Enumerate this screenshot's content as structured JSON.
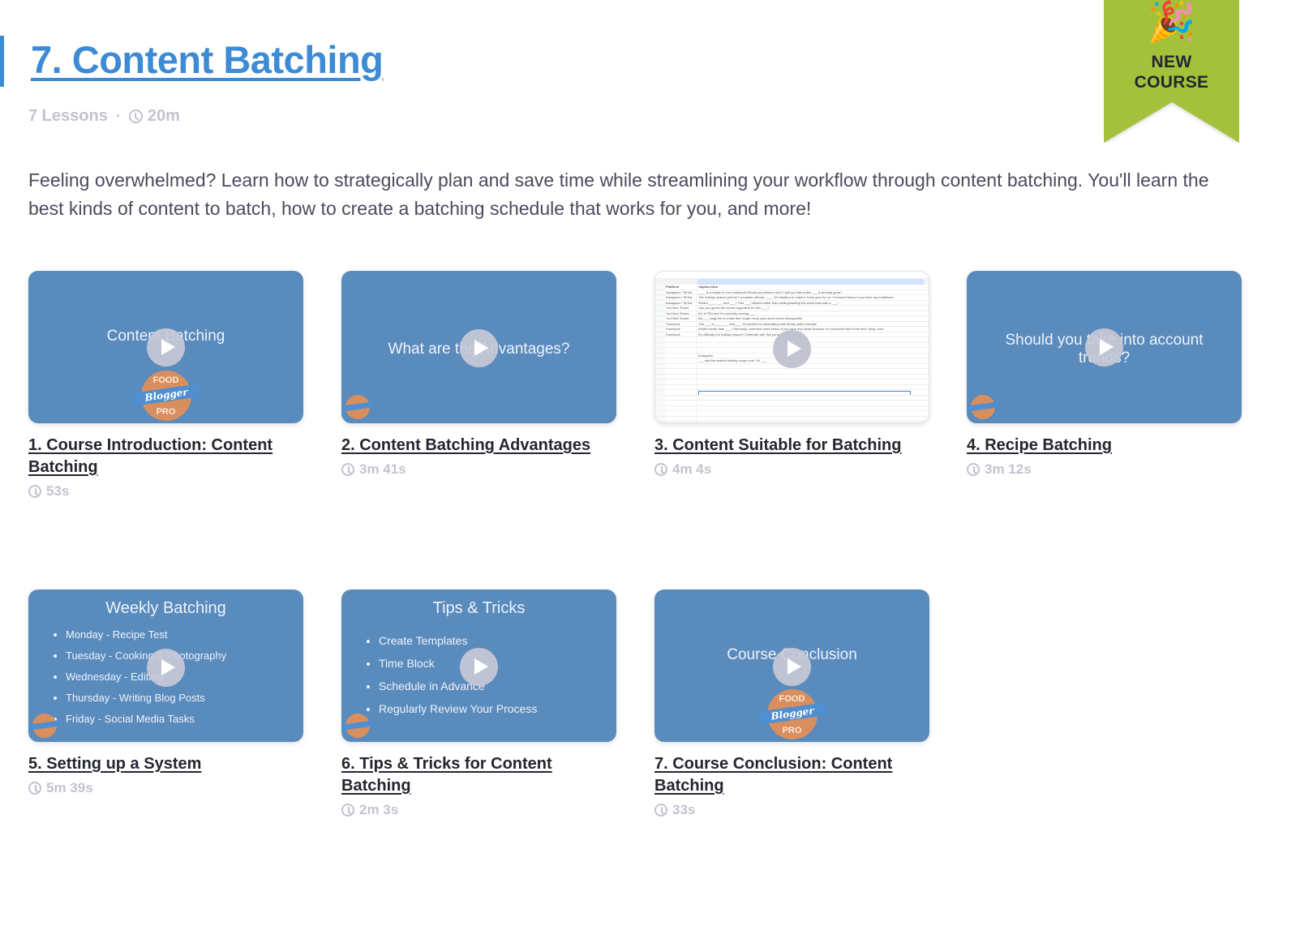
{
  "course": {
    "title": "7. Content Batching",
    "lessons_count": "7 Lessons",
    "separator": "·",
    "total_duration": "20m",
    "description": "Feeling overwhelmed? Learn how to strategically plan and save time while streamlining your workflow through content batching. You'll learn the best kinds of content to batch, how to create a batching schedule that works for you, and more!",
    "accent_color": "#3d8bd4"
  },
  "badge": {
    "icon": "party-popper-icon",
    "emoji": "🎉",
    "line1": "NEW",
    "line2": "COURSE",
    "color": "#a3c13b"
  },
  "logo": {
    "top": "FOOD",
    "middle": "Blogger",
    "bottom": "PRO"
  },
  "lessons": [
    {
      "title": "1. Course Introduction: Content Batching",
      "duration": "53s",
      "thumb_text": "Content Batching"
    },
    {
      "title": "2. Content Batching Advantages",
      "duration": "3m 41s",
      "thumb_text": "What are the Advantages?"
    },
    {
      "title": "3. Content Suitable for Batching",
      "duration": "4m 4s",
      "thumb_sheet": {
        "headers": [
          "Platform",
          "Caption Idea"
        ],
        "rows": [
          [
            "Instagram / TikTok",
            "____ is a staple in our household! Would you believe me if I told you this entire ___ is already gone?"
          ],
          [
            "Instagram / TikTok",
            "The holiday season just isn't complete without ____. It's tradition to make it every year for us. Comment below if you have any traditions!"
          ],
          [
            "Instagram / TikTok",
            "What's ___, ___, and ___? This ___! What's better than ending/starting the week than with a ___!"
          ],
          [
            "YouTube Shorts",
            "Can you guess the secret ingredient for this ___?"
          ],
          [
            "YouTube Shorts",
            "It's 10 PM and I'm currently craving ___."
          ],
          [
            "YouTube Shorts",
            "My ___ begs me to make this recipe every year and it never dissapoints!"
          ],
          [
            "Facebook",
            "This ___ is ___, ___, and ___. It's perfect for celebrating with family and/or friends!"
          ],
          [
            "Facebook",
            "What's better than ___? Seriously, comment down below if you have any ideas because I'm convinced this is the best. thing. ever."
          ],
          [
            "Facebook",
            "It's officially the holiday season! Celebrate with this perfect festive treat."
          ]
        ],
        "examples_label": "Examples:",
        "example": "___ aka the easiest holiday recipe ever. It's ___"
      }
    },
    {
      "title": "4. Recipe Batching",
      "duration": "3m 12s",
      "thumb_text": "Should you take into account trends?"
    },
    {
      "title": "5. Setting up a System",
      "duration": "5m 39s",
      "thumb_heading": "Weekly Batching",
      "thumb_list": [
        "Monday - Recipe Test",
        "Tuesday - Cooking & Photography",
        "Wednesday - Editing",
        "Thursday - Writing Blog Posts",
        "Friday - Social Media Tasks"
      ]
    },
    {
      "title": "6. Tips & Tricks for Content Batching",
      "duration": "2m 3s",
      "thumb_heading": "Tips & Tricks",
      "thumb_list": [
        "Create Templates",
        "Time Block",
        "Schedule in Advance",
        "Regularly Review Your Process"
      ]
    },
    {
      "title": "7. Course Conclusion: Content Batching",
      "duration": "33s",
      "thumb_text": "Course Conclusion"
    }
  ]
}
